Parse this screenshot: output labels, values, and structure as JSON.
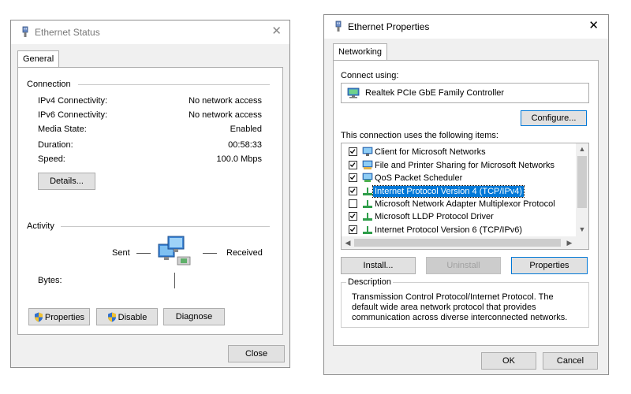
{
  "status_window": {
    "title": "Ethernet Status",
    "tab_general": "General",
    "connection_heading": "Connection",
    "rows": [
      {
        "label": "IPv4 Connectivity:",
        "value": "No network access"
      },
      {
        "label": "IPv6 Connectivity:",
        "value": "No network access"
      },
      {
        "label": "Media State:",
        "value": "Enabled"
      },
      {
        "label": "Duration:",
        "value": "00:58:33"
      },
      {
        "label": "Speed:",
        "value": "100.0 Mbps"
      }
    ],
    "details_label": "Details...",
    "activity_heading": "Activity",
    "sent_label": "Sent",
    "received_label": "Received",
    "bytes_label": "Bytes:",
    "properties_label": "Properties",
    "disable_label": "Disable",
    "diagnose_label": "Diagnose",
    "close_label": "Close"
  },
  "props_window": {
    "title": "Ethernet Properties",
    "tab_networking": "Networking",
    "connect_using_label": "Connect using:",
    "adapter_name": "Realtek PCIe GbE Family Controller",
    "configure_label": "Configure...",
    "items_label": "This connection uses the following items:",
    "items": [
      {
        "label": "Client for Microsoft Networks",
        "checked": true,
        "icon": "network-client-icon"
      },
      {
        "label": "File and Printer Sharing for Microsoft Networks",
        "checked": true,
        "icon": "file-printer-sharing-icon"
      },
      {
        "label": "QoS Packet Scheduler",
        "checked": true,
        "icon": "qos-scheduler-icon"
      },
      {
        "label": "Internet Protocol Version 4 (TCP/IPv4)",
        "checked": true,
        "icon": "protocol-icon",
        "selected": true
      },
      {
        "label": "Microsoft Network Adapter Multiplexor Protocol",
        "checked": false,
        "icon": "protocol-icon"
      },
      {
        "label": "Microsoft LLDP Protocol Driver",
        "checked": true,
        "icon": "protocol-icon"
      },
      {
        "label": "Internet Protocol Version 6 (TCP/IPv6)",
        "checked": true,
        "icon": "protocol-icon"
      }
    ],
    "install_label": "Install...",
    "uninstall_label": "Uninstall",
    "properties_label": "Properties",
    "description_heading": "Description",
    "description_text": "Transmission Control Protocol/Internet Protocol. The default wide area network protocol that provides communication across diverse interconnected networks.",
    "ok_label": "OK",
    "cancel_label": "Cancel"
  },
  "colors": {
    "selection": "#0078d7",
    "window_bg": "#f0f0f0",
    "title_bg": "#ffffff",
    "button_bg": "#e1e1e1"
  }
}
